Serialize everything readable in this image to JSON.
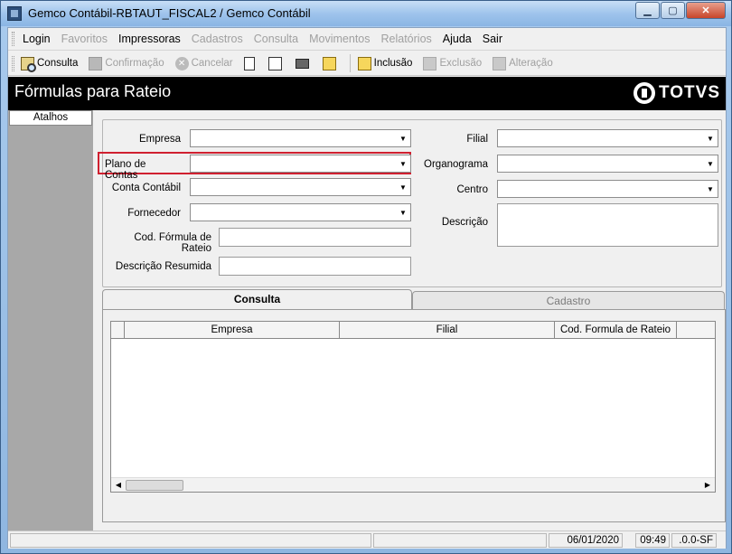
{
  "window": {
    "title": "Gemco Contábil-RBTAUT_FISCAL2 / Gemco Contábil"
  },
  "menu": [
    {
      "label": "Login",
      "disabled": false
    },
    {
      "label": "Favoritos",
      "disabled": true
    },
    {
      "label": "Impressoras",
      "disabled": false
    },
    {
      "label": "Cadastros",
      "disabled": true
    },
    {
      "label": "Consulta",
      "disabled": true
    },
    {
      "label": "Movimentos",
      "disabled": true
    },
    {
      "label": "Relatórios",
      "disabled": true
    },
    {
      "label": "Ajuda",
      "disabled": false
    },
    {
      "label": "Sair",
      "disabled": false
    }
  ],
  "toolbar": {
    "consulta": "Consulta",
    "confirmacao": "Confirmação",
    "cancelar": "Cancelar",
    "inclusao": "Inclusão",
    "exclusao": "Exclusão",
    "alteracao": "Alteração"
  },
  "header": {
    "title": "Fórmulas para Rateio",
    "brand": "TOTVS"
  },
  "shortcuts": {
    "tab": "Atalhos"
  },
  "form": {
    "empresa_label": "Empresa",
    "plano_label": "Plano de Contas",
    "conta_label": "Conta Contábil",
    "fornecedor_label": "Fornecedor",
    "cod_formula_label": "Cod. Fórmula de Rateio",
    "descricao_resumida_label": "Descrição Resumida",
    "filial_label": "Filial",
    "organograma_label": "Organograma",
    "centro_label": "Centro",
    "descricao_label": "Descrição"
  },
  "tabs": {
    "consulta": "Consulta",
    "cadastro": "Cadastro"
  },
  "grid": {
    "columns": [
      "Empresa",
      "Filial",
      "Cod. Formula de Rateio"
    ]
  },
  "status": {
    "date": "06/01/2020",
    "time": "09:49",
    "version": ".0.0-SF"
  },
  "colors": {
    "highlight": "#d02030",
    "header_bg": "#000000"
  }
}
